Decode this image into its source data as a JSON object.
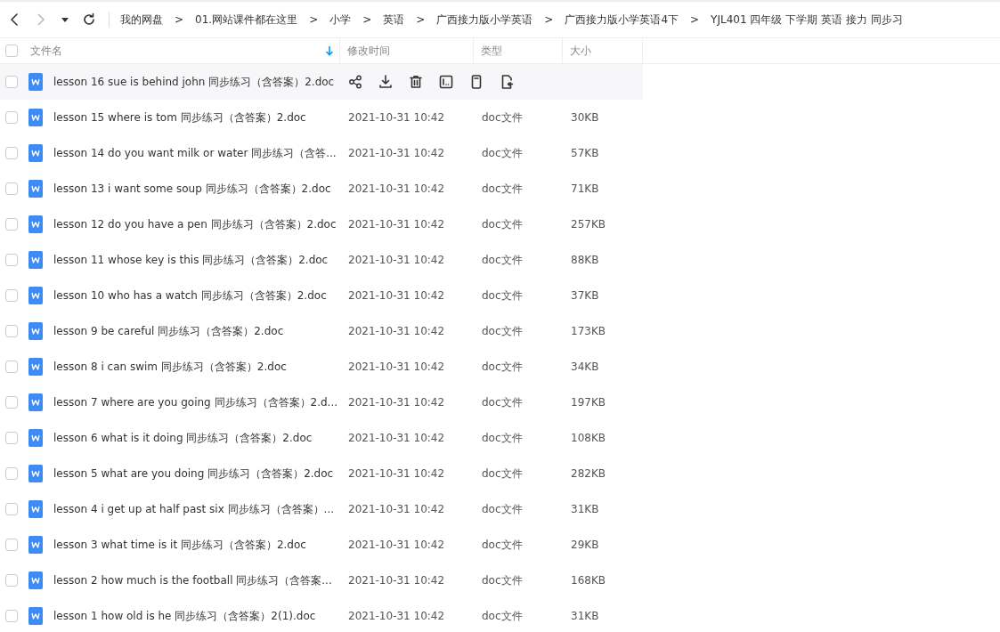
{
  "breadcrumb_separator": ">",
  "select_all": {
    "checked": false
  },
  "breadcrumb": [
    "我的网盘",
    "01.网站课件都在这里",
    "小学",
    "英语",
    "广西接力版小学英语",
    "广西接力版小学英语4下",
    "YJL401 四年级 下学期 英语 接力 同步习"
  ],
  "columns": [
    {
      "label": "文件名",
      "sorted": true
    },
    {
      "label": "修改时间",
      "sorted": false
    },
    {
      "label": "类型",
      "sorted": false
    },
    {
      "label": "大小",
      "sorted": false
    }
  ],
  "rows": [
    {
      "name": "lesson 16 sue is behind john 同步练习（含答案）2.doc",
      "hovered": true
    },
    {
      "name": "lesson 15 where is tom 同步练习（含答案）2.doc",
      "modified": "2021-10-31 10:42",
      "type": "doc文件",
      "size": "30KB",
      "hovered": false
    },
    {
      "name": "lesson 14 do you want milk or water 同步练习（含答...",
      "modified": "2021-10-31 10:42",
      "type": "doc文件",
      "size": "57KB",
      "hovered": false
    },
    {
      "name": "lesson 13 i want some soup 同步练习（含答案）2.doc",
      "modified": "2021-10-31 10:42",
      "type": "doc文件",
      "size": "71KB",
      "hovered": false
    },
    {
      "name": "lesson 12 do you have a pen 同步练习（含答案）2.doc",
      "modified": "2021-10-31 10:42",
      "type": "doc文件",
      "size": "257KB",
      "hovered": false
    },
    {
      "name": "lesson 11 whose key is this 同步练习（含答案）2.doc",
      "modified": "2021-10-31 10:42",
      "type": "doc文件",
      "size": "88KB",
      "hovered": false
    },
    {
      "name": "lesson 10 who has a watch 同步练习（含答案）2.doc",
      "modified": "2021-10-31 10:42",
      "type": "doc文件",
      "size": "37KB",
      "hovered": false
    },
    {
      "name": "lesson 9 be careful 同步练习（含答案）2.doc",
      "modified": "2021-10-31 10:42",
      "type": "doc文件",
      "size": "173KB",
      "hovered": false
    },
    {
      "name": "lesson 8 i can swim 同步练习（含答案）2.doc",
      "modified": "2021-10-31 10:42",
      "type": "doc文件",
      "size": "34KB",
      "hovered": false
    },
    {
      "name": "lesson 7 where are you going 同步练习（含答案）2.d...",
      "modified": "2021-10-31 10:42",
      "type": "doc文件",
      "size": "197KB",
      "hovered": false
    },
    {
      "name": "lesson 6 what is it doing 同步练习（含答案）2.doc",
      "modified": "2021-10-31 10:42",
      "type": "doc文件",
      "size": "108KB",
      "hovered": false
    },
    {
      "name": "lesson 5 what are you doing 同步练习（含答案）2.doc",
      "modified": "2021-10-31 10:42",
      "type": "doc文件",
      "size": "282KB",
      "hovered": false
    },
    {
      "name": "lesson 4 i get up at half past six 同步练习（含答案）...",
      "modified": "2021-10-31 10:42",
      "type": "doc文件",
      "size": "31KB",
      "hovered": false
    },
    {
      "name": "lesson 3 what time is it 同步练习（含答案）2.doc",
      "modified": "2021-10-31 10:42",
      "type": "doc文件",
      "size": "29KB",
      "hovered": false
    },
    {
      "name": "lesson 2 how much is the football 同步练习（含答案...",
      "modified": "2021-10-31 10:42",
      "type": "doc文件",
      "size": "168KB",
      "hovered": false
    },
    {
      "name": "lesson 1 how old is he 同步练习（含答案）2(1).doc",
      "modified": "2021-10-31 10:42",
      "type": "doc文件",
      "size": "31KB",
      "hovered": false
    }
  ]
}
